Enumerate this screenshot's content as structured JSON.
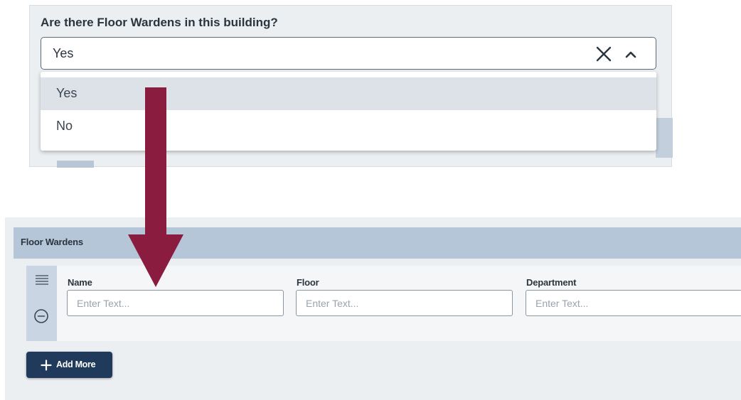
{
  "question": {
    "label": "Are there Floor Wardens in this building?",
    "selected_value": "Yes",
    "options": [
      "Yes",
      "No"
    ],
    "highlighted_option": "Yes"
  },
  "icons": {
    "clear": "close-icon",
    "toggle": "chevron-up-icon",
    "drag": "drag-handle-icon",
    "remove": "minus-circle-icon",
    "add": "plus-icon"
  },
  "section": {
    "title": "Floor Wardens",
    "fields": [
      {
        "label": "Name",
        "placeholder": "Enter Text..."
      },
      {
        "label": "Floor",
        "placeholder": "Enter Text..."
      },
      {
        "label": "Department",
        "placeholder": "Enter Text..."
      }
    ],
    "add_more_label": "Add More"
  },
  "colors": {
    "arrow": "#8a1c40",
    "header": "#b5c6d8",
    "button": "#1f3a5a",
    "option_highlight": "#dde2e8"
  }
}
